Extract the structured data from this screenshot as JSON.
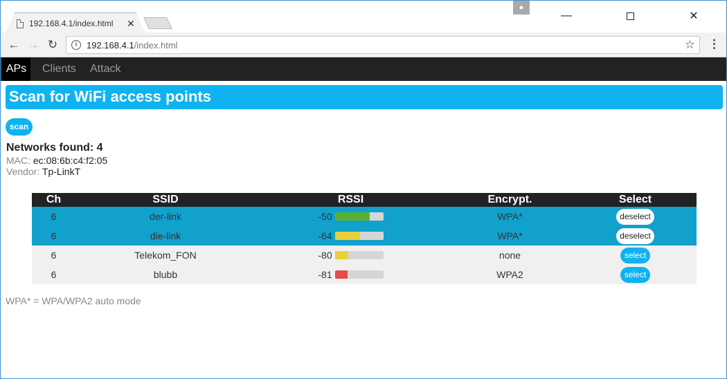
{
  "browser": {
    "tab_title": "192.168.4.1/index.html",
    "tab_close": "✕",
    "url_host": "192.168.4.1",
    "url_path": "/index.html",
    "minimize": "—",
    "close": "✕"
  },
  "nav": {
    "items": [
      {
        "label": "APs",
        "active": true
      },
      {
        "label": "Clients",
        "active": false
      },
      {
        "label": "Attack",
        "active": false
      }
    ]
  },
  "page": {
    "heading": "Scan for WiFi access points",
    "scan_label": "scan",
    "networks_found": "Networks found: 4",
    "mac_label": "MAC:",
    "mac_value": "ec:08:6b:c4:f2:05",
    "vendor_label": "Vendor:",
    "vendor_value": "Tp-LinkT",
    "footnote": "WPA* = WPA/WPA2 auto mode"
  },
  "table": {
    "headers": [
      "Ch",
      "SSID",
      "RSSI",
      "Encrypt.",
      "Select"
    ],
    "rows": [
      {
        "ch": "6",
        "ssid": "der-link",
        "rssi": "-50",
        "rssi_pct": 0.72,
        "bar_color": "#5ab033",
        "enc": "WPA*",
        "selected": true,
        "action": "deselect"
      },
      {
        "ch": "6",
        "ssid": "die-link",
        "rssi": "-64",
        "rssi_pct": 0.52,
        "bar_color": "#e8d03a",
        "enc": "WPA*",
        "selected": true,
        "action": "deselect"
      },
      {
        "ch": "6",
        "ssid": "Telekom_FON",
        "rssi": "-80",
        "rssi_pct": 0.28,
        "bar_color": "#e8d03a",
        "enc": "none",
        "selected": false,
        "action": "select"
      },
      {
        "ch": "6",
        "ssid": "blubb",
        "rssi": "-81",
        "rssi_pct": 0.26,
        "bar_color": "#e84a4a",
        "enc": "WPA2",
        "selected": false,
        "action": "select"
      }
    ]
  },
  "colors": {
    "accent": "#0eb3ef",
    "selected_row": "#12a1cc",
    "nav_bg": "#222222"
  }
}
